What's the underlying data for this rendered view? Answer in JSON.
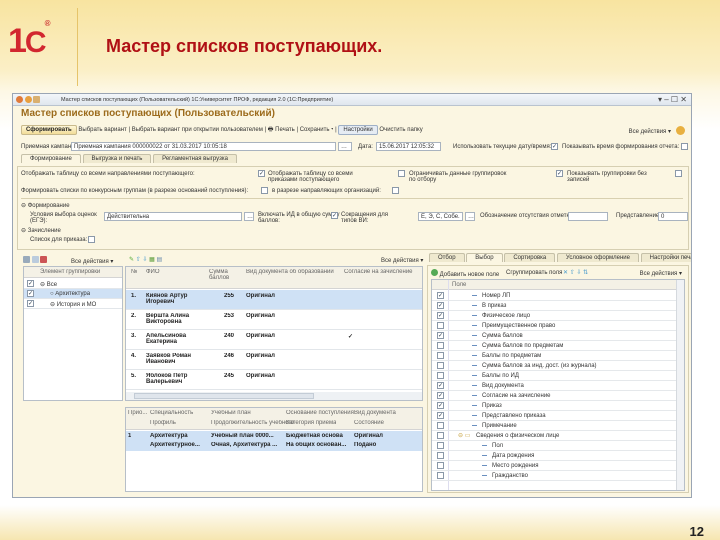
{
  "slide": {
    "title": "Мастер списков поступающих.",
    "page_number": "12",
    "logo_text": "1С"
  },
  "window": {
    "title": "Мастер списков поступающих (Пользовательский)   1С:Университет ПРОФ, редакция 2.0  (1С:Предприятие)",
    "form_title": "Мастер списков поступающих (Пользовательский)",
    "toolbar": {
      "generate": "Сформировать",
      "choose_variant": "Выбрать вариант",
      "choose_variant_user": "Выбрать вариант при открытии пользователем",
      "print": "Печать",
      "save": "Сохранить ▾",
      "settings": "Настройки",
      "clear": "Очистить папку",
      "all_actions": "Все действия ▾"
    },
    "campaign_label": "Приемная кампания:",
    "campaign_value": "Приемная кампания 000000022 от 31.03.2017 10:05:18",
    "date_label": "Дата:",
    "date_value": "15.06.2017 12:05:32",
    "use_current_label": "Использовать текущие дату/время:",
    "use_current": true,
    "show_time_label": "Показывать время формирования отчета:",
    "show_time": false
  },
  "tabs": [
    "Формирование",
    "Выгрузка и печать",
    "Регламентная выгрузка"
  ],
  "options": {
    "show_table_label": "Отображать таблицу со всеми направлениями поступающего:",
    "show_table_admitted_label": "Отображать таблицу со всеми приказами поступающего",
    "show_table_admitted": true,
    "limit_grouping_label": "Ограничивать данные группировок по отбору",
    "limit_grouping": false,
    "show_empty_label": "Показывать группировки без записей",
    "show_empty": true,
    "competitive_label": "Формировать списки по конкурсным группам (в разрезе оснований поступления):",
    "by_org_label": "в разрезе направляющих организаций:",
    "section1": "Формирование",
    "conditions_label": "Условия выбора оценок (ЕГЭ):",
    "conditions_value": "Действительна",
    "include_id_label": "Включать ИД в общую сумму баллов:",
    "include_id": true,
    "abbr_label": "Сокращения для типов ВИ:",
    "abbr_value": "Е, Э, С, Собе.",
    "missing_mark_label": "Обозначение отсутствия отметки:",
    "missing_mark_value": "",
    "empty_repr_label": "Представление пуст.:",
    "empty_repr_value": "0",
    "section2": "Зачисление",
    "order_list_label": "Список для приказа:"
  },
  "tree": {
    "all_actions": "Все действия ▾",
    "header": "Элемент группировки",
    "items": [
      {
        "label": "Все",
        "checked": true
      },
      {
        "label": "Архитектура",
        "checked": true
      },
      {
        "label": "История и МО",
        "checked": true
      }
    ]
  },
  "grid": {
    "all_actions": "Все действия ▾",
    "columns": [
      "№",
      "ФИО",
      "Сумма баллов",
      "Вид документа об образовании",
      "Согласие на зачисление"
    ],
    "rows": [
      {
        "n": "1.",
        "fio": "Киянов Артур Игоревич",
        "sum": "255",
        "doc": "Оригинал",
        "agree": ""
      },
      {
        "n": "2.",
        "fio": "Вершта Алина Викторовна",
        "sum": "253",
        "doc": "Оригинал",
        "agree": ""
      },
      {
        "n": "3.",
        "fio": "Апельсинова Екатерина",
        "sum": "240",
        "doc": "Оригинал",
        "agree": "✓"
      },
      {
        "n": "4.",
        "fio": "Заявков Роман Иванович",
        "sum": "246",
        "doc": "Оригинал",
        "agree": ""
      },
      {
        "n": "5.",
        "fio": "Яблоков Петр Валерьевич",
        "sum": "245",
        "doc": "Оригинал",
        "agree": ""
      }
    ]
  },
  "detail": {
    "columns_top": [
      "Прио...",
      "Специальность",
      "Учебный план",
      "Основание поступления",
      "Вид документа"
    ],
    "columns_bottom": [
      "",
      "Профиль",
      "Продолжительность учебного",
      "Категория приема",
      "Состояние"
    ],
    "row_top": [
      "1",
      "Архитектура",
      "Учебный план 0000...",
      "Бюджетная основа",
      "Оригинал"
    ],
    "row_bottom": [
      "",
      "Архитектурное...",
      "Очная, Архитектура ...",
      "На общих основан...",
      "Подано"
    ]
  },
  "settings": {
    "tabs": [
      "Отбор",
      "Выбор",
      "Сортировка",
      "Условное оформление",
      "Настройки печати"
    ],
    "add_field": "Добавить новое поле",
    "group_fields": "Сгруппировать поля",
    "all_actions": "Все действия ▾",
    "header": "Поле",
    "fields": [
      {
        "label": "Номер ЛП",
        "checked": true
      },
      {
        "label": "В приказ",
        "checked": true
      },
      {
        "label": "Физическое лицо",
        "checked": true
      },
      {
        "label": "Преимущественное право",
        "checked": false
      },
      {
        "label": "Сумма баллов",
        "checked": true
      },
      {
        "label": "Сумма баллов по предметам",
        "checked": false
      },
      {
        "label": "Баллы по предметам",
        "checked": false
      },
      {
        "label": "Сумма баллов за инд. дост. (из журнала)",
        "checked": false
      },
      {
        "label": "Баллы по ИД",
        "checked": false
      },
      {
        "label": "Вид документа",
        "checked": true
      },
      {
        "label": "Согласие на зачисление",
        "checked": true
      },
      {
        "label": "Приказ",
        "checked": true
      },
      {
        "label": "Представлено приказа",
        "checked": true
      },
      {
        "label": "Примечание",
        "checked": false
      },
      {
        "label": "Сведения о физическом лице",
        "checked": false,
        "group": true
      },
      {
        "label": "Пол",
        "checked": false
      },
      {
        "label": "Дата рождения",
        "checked": false
      },
      {
        "label": "Место рождения",
        "checked": false
      },
      {
        "label": "Гражданство",
        "checked": false
      }
    ]
  }
}
